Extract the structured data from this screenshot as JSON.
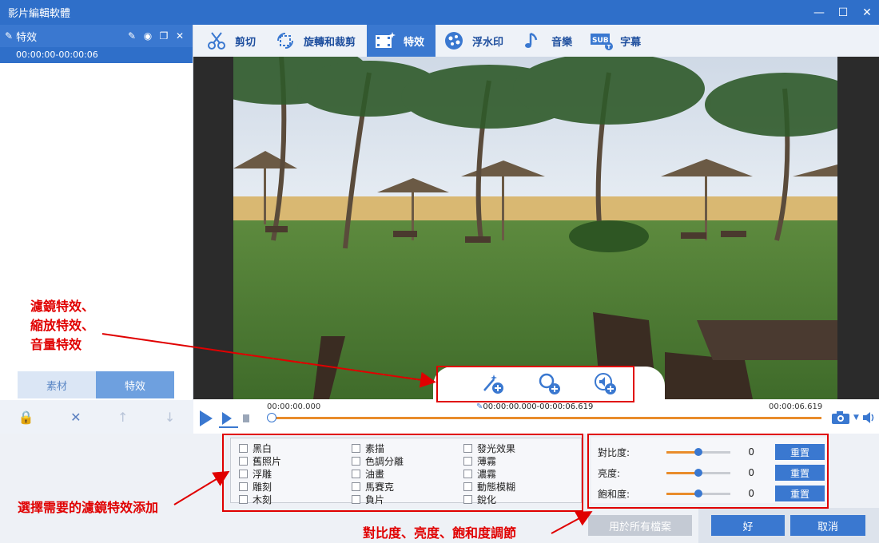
{
  "window": {
    "title": "影片編輯軟體"
  },
  "left_panel": {
    "header_label": "特效",
    "item": "00:00:00-00:00:06",
    "tabs": [
      "素材",
      "特效"
    ]
  },
  "tabs": [
    {
      "label": "剪切",
      "icon": "cut-icon"
    },
    {
      "label": "旋轉和裁剪",
      "icon": "rotate-crop-icon"
    },
    {
      "label": "特效",
      "icon": "effects-icon",
      "active": true
    },
    {
      "label": "浮水印",
      "icon": "watermark-icon"
    },
    {
      "label": "音樂",
      "icon": "music-note-icon"
    },
    {
      "label": "字幕",
      "icon": "subtitle-icon"
    }
  ],
  "timeline": {
    "start": "00:00:00.000",
    "range": "00:00:00.000-00:00:06.619",
    "end": "00:00:06.619"
  },
  "filters": {
    "col1": [
      "黑白",
      "舊照片",
      "浮雕",
      "雕刻",
      "木刻"
    ],
    "col2": [
      "素描",
      "色調分離",
      "油畫",
      "馬賽克",
      "負片"
    ],
    "col3": [
      "發光效果",
      "薄霧",
      "濃霧",
      "動態模糊",
      "銳化"
    ]
  },
  "adjustments": [
    {
      "label": "對比度:",
      "value": "0",
      "reset": "重置",
      "level": 0.5
    },
    {
      "label": "亮度:",
      "value": "0",
      "reset": "重置",
      "level": 0.5
    },
    {
      "label": "飽和度:",
      "value": "0",
      "reset": "重置",
      "level": 0.5
    }
  ],
  "buttons": {
    "apply_all": "用於所有檔案",
    "ok": "好",
    "cancel": "取消"
  },
  "annotations": {
    "effects_line1": "濾鏡特效、",
    "effects_line2": "縮放特效、",
    "effects_line3": "音量特效",
    "filters_note": "選擇需要的濾鏡特效添加",
    "adjust_note": "對比度、亮度、飽和度調節"
  },
  "colors": {
    "accent": "#3a78d0",
    "annotation": "#e00000",
    "progress": "#e98c2b"
  }
}
